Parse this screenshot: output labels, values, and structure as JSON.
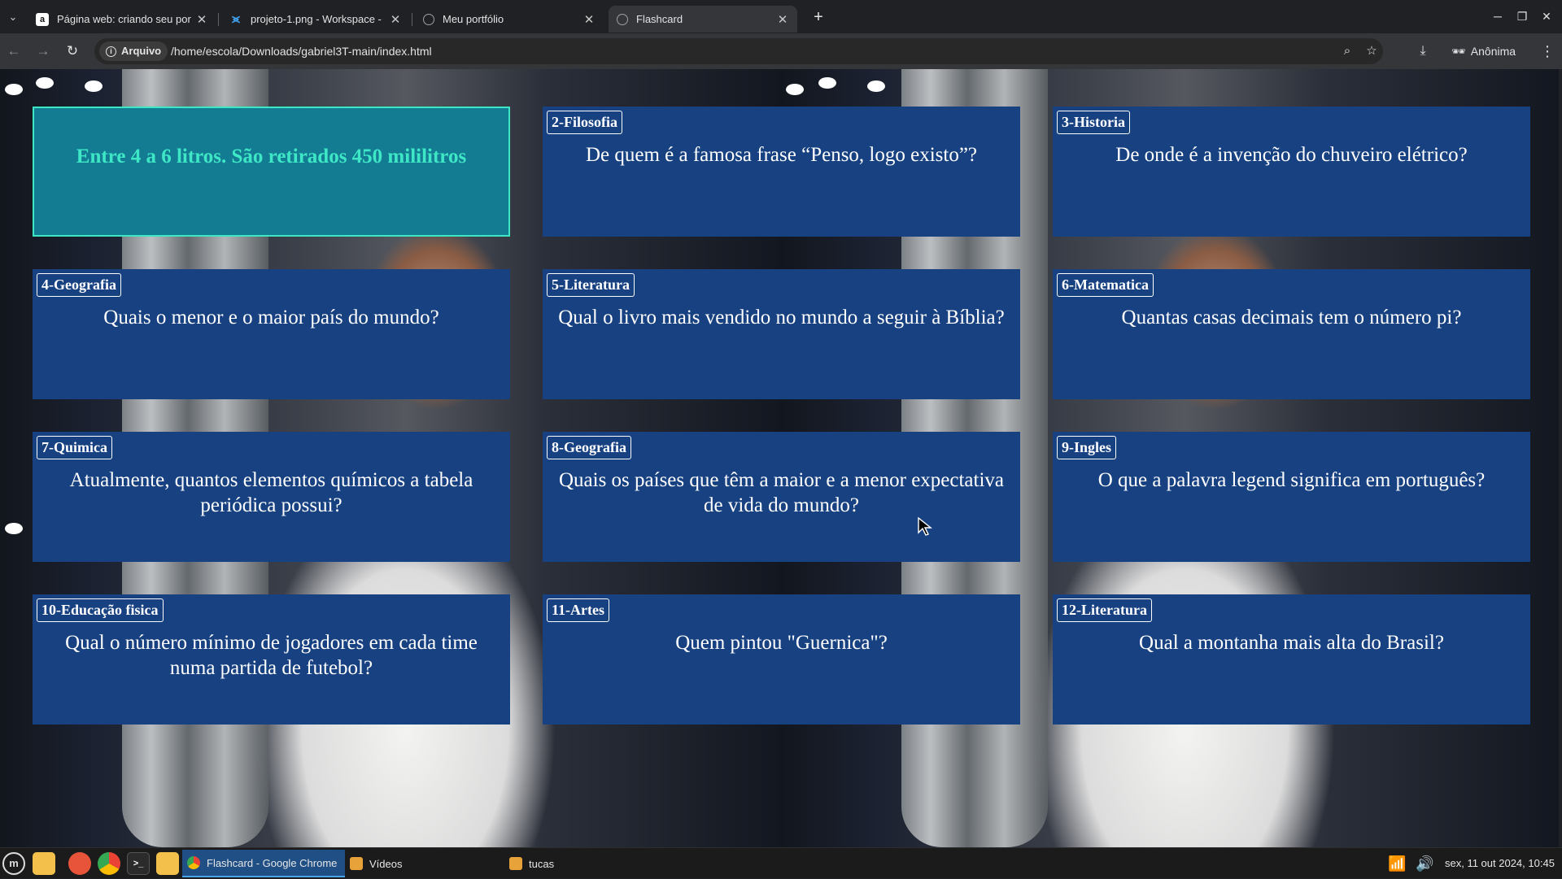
{
  "browser": {
    "tabs": [
      {
        "title": "Página web: criando seu por",
        "favicon": "a",
        "favicon_color": "#1a1a1a"
      },
      {
        "title": "projeto-1.png - Workspace -",
        "favicon": "vscode",
        "favicon_color": "#3ea1f0"
      },
      {
        "title": "Meu portfólio",
        "favicon": "globe",
        "favicon_color": "#9aa0a6"
      },
      {
        "title": "Flashcard",
        "favicon": "globe",
        "favicon_color": "#9aa0a6"
      }
    ],
    "active_tab": 3,
    "chip_label": "Arquivo",
    "url": "/home/escola/Downloads/gabriel3T-main/index.html",
    "incognito_label": "Anônima"
  },
  "cards": [
    {
      "tag": "",
      "text": "Entre 4 a 6 litros. São retirados 450 mililitros",
      "flipped": true
    },
    {
      "tag": "2-Filosofia",
      "text": "De quem é a famosa frase “Penso, logo existo”?"
    },
    {
      "tag": "3-Historia",
      "text": "De onde é a invenção do chuveiro elétrico?"
    },
    {
      "tag": "4-Geografia",
      "text": "Quais o menor e o maior país do mundo?"
    },
    {
      "tag": "5-Literatura",
      "text": "Qual o livro mais vendido no mundo a seguir à Bíblia?"
    },
    {
      "tag": "6-Matematica",
      "text": "Quantas casas decimais tem o número pi?"
    },
    {
      "tag": "7-Quimica",
      "text": "Atualmente, quantos elementos químicos a tabela periódica possui?"
    },
    {
      "tag": "8-Geografia",
      "text": "Quais os países que têm a maior e a menor expectativa de vida do mundo?"
    },
    {
      "tag": "9-Ingles",
      "text": "O que a palavra legend significa em português?"
    },
    {
      "tag": "10-Educação fisica",
      "text": "Qual o número mínimo de jogadores em cada time numa partida de futebol?"
    },
    {
      "tag": "11-Artes",
      "text": "Quem pintou \"Guernica\"?"
    },
    {
      "tag": "12-Literatura",
      "text": "Qual a montanha mais alta do Brasil?"
    }
  ],
  "taskbar": {
    "items": [
      {
        "label": "Flashcard - Google Chrome",
        "active": true,
        "icon_color": "#4285f4"
      },
      {
        "label": "Vídeos",
        "active": false,
        "icon_color": "#e8a23a"
      },
      {
        "label": "tucas",
        "active": false,
        "icon_color": "#e8a23a"
      }
    ],
    "clock": "sex, 11 out 2024, 10:45"
  }
}
